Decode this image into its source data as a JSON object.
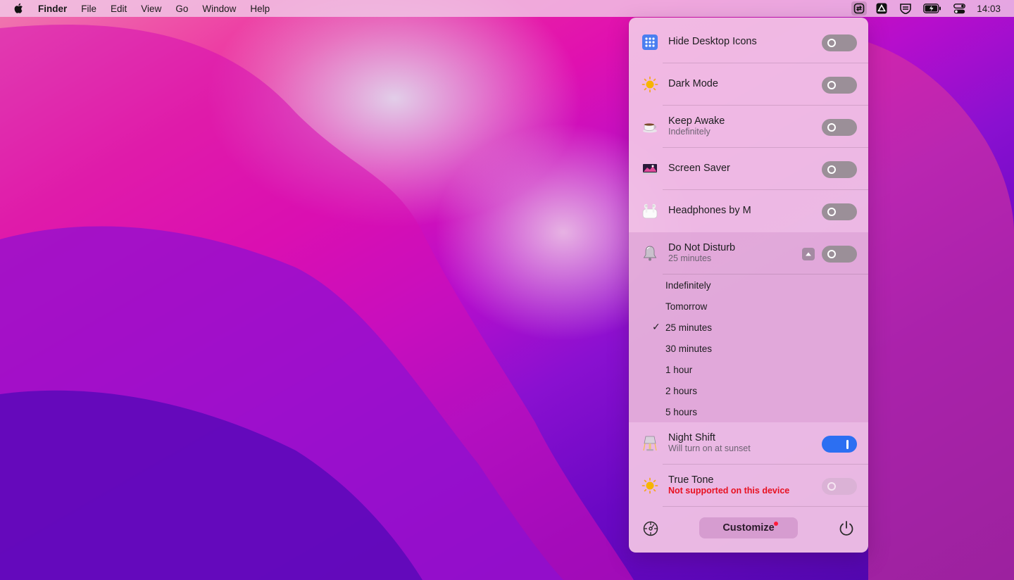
{
  "menubar": {
    "app_name": "Finder",
    "menus": [
      "File",
      "Edit",
      "View",
      "Go",
      "Window",
      "Help"
    ],
    "status_icons": [
      "one-switch-icon",
      "cloud-drive-icon",
      "shield-wallet-icon",
      "battery-charging-icon",
      "control-center-icon"
    ],
    "clock": "14:03"
  },
  "panel": {
    "rows": [
      {
        "id": "hide-desktop-icons",
        "title": "Hide Desktop Icons",
        "subtitle": "",
        "icon": "grid-icon",
        "state": "off"
      },
      {
        "id": "dark-mode",
        "title": "Dark Mode",
        "subtitle": "",
        "icon": "sun-icon",
        "state": "off"
      },
      {
        "id": "keep-awake",
        "title": "Keep Awake",
        "subtitle": "Indefinitely",
        "icon": "coffee-cup-icon",
        "state": "off"
      },
      {
        "id": "screen-saver",
        "title": "Screen Saver",
        "subtitle": "",
        "icon": "monitor-icon",
        "state": "off"
      },
      {
        "id": "headphones",
        "title": "Headphones by M",
        "subtitle": "",
        "icon": "airpods-icon",
        "state": "off"
      },
      {
        "id": "do-not-disturb",
        "title": "Do Not Disturb",
        "subtitle": "25 minutes",
        "icon": "bell-icon",
        "state": "off"
      }
    ],
    "dnd_options": [
      "Indefinitely",
      "Tomorrow",
      "25 minutes",
      "30 minutes",
      "1 hour",
      "2 hours",
      "5 hours"
    ],
    "dnd_selected": "25 minutes",
    "rows_after": [
      {
        "id": "night-shift",
        "title": "Night Shift",
        "subtitle": "Will turn on at sunset",
        "icon": "lamp-icon",
        "state": "on"
      },
      {
        "id": "true-tone",
        "title": "True Tone",
        "subtitle": "Not supported on this device",
        "icon": "sun-icon",
        "state": "disabled"
      }
    ],
    "footer": {
      "customize_label": "Customize"
    }
  },
  "colors": {
    "toggle_on": "#2c6ff2",
    "toggle_off": "#9b8f98",
    "warning_text": "#e81020",
    "badge_dot": "#ff1a3a"
  }
}
